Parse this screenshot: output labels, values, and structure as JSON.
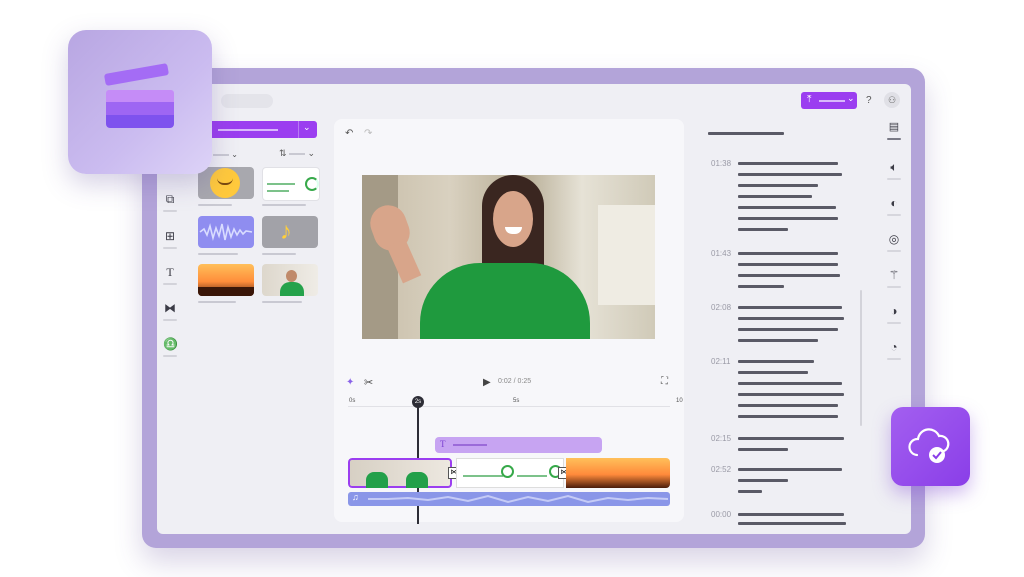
{
  "preview": {
    "time_current": "0:02",
    "time_separator": "/",
    "time_total": "0:25"
  },
  "timeline": {
    "playhead_label": "2s",
    "ticks": [
      "0s",
      "5s",
      "10"
    ]
  },
  "toolbar": {
    "help_label": "?"
  },
  "transcript": {
    "timestamps": [
      "01:38",
      "01:43",
      "02:08",
      "02:11",
      "02:15",
      "02:52",
      "00:00"
    ]
  },
  "colors": {
    "accent": "#9b3ef0",
    "frame": "#b3a4d9",
    "screen_bg": "#efeff4",
    "text_track": "#c7a4f2",
    "audio_track": "#8a96e8"
  },
  "icons": {
    "app_logo": "clapperboard-icon",
    "cloud": "cloud-check-icon"
  }
}
